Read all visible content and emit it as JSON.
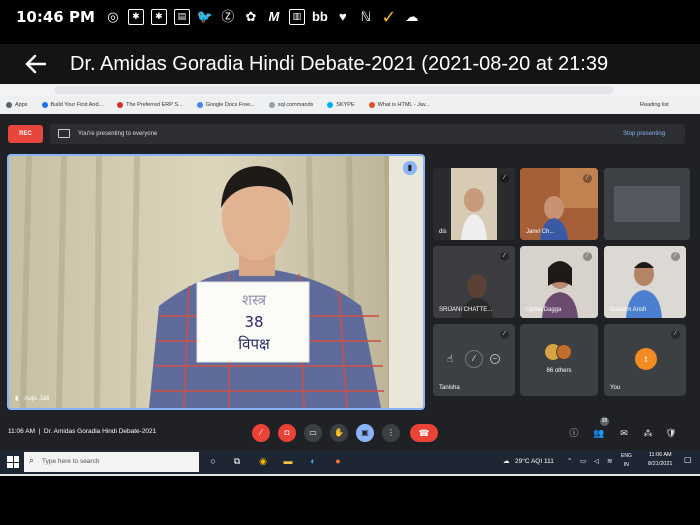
{
  "status_bar": {
    "time": "10:46 PM",
    "icons": [
      "whatsapp-icon",
      "stamp-icon",
      "stamp-icon",
      "flipboard-icon",
      "twitter-icon",
      "z-icon",
      "photos-icon",
      "m-icon",
      "newspaper-icon",
      "bb-icon",
      "heart-icon",
      "nn-icon",
      "check-icon",
      "cloud-icon"
    ]
  },
  "player": {
    "title": "Dr. Amidas Goradia Hindi Debate-2021 (2021-08-20 at 21:39"
  },
  "browser": {
    "bookmarks": [
      "Apps",
      "Build Your First And...",
      "The Preferred ERP S...",
      "Google Docs Free...",
      "sql commands",
      "SKYPE",
      "What is HTML - Jav..."
    ],
    "reading_list": "Reading list"
  },
  "meet": {
    "rec_label": "REC",
    "presenting_text": "You're presenting to everyone",
    "stop_presenting": "Stop presenting",
    "main_speaker_name": "Aujis Jalil",
    "card_text": [
      "शस्त्र",
      "38",
      "विपक्ष"
    ],
    "tiles": [
      {
        "name": "dis",
        "bg": "#d7cbb5"
      },
      {
        "name": "Janvi Ch...",
        "bg": "#b86b3a"
      },
      {
        "name": "",
        "bg": "#4a4d52"
      },
      {
        "name": "SRIJANI CHATTE...",
        "bg": "#3f4144"
      },
      {
        "name": "Upma Dagga",
        "bg": "#cfc8c2"
      },
      {
        "name": "Gautam Ansh",
        "bg": "#d6d3cf"
      },
      {
        "name": "Tanisha",
        "bg": "#3c4043"
      },
      {
        "name": "86 others",
        "bg": "#3c4043"
      },
      {
        "name": "You",
        "bg": "#3c4043"
      }
    ],
    "you_initial": "t",
    "meeting_time": "11:06 AM",
    "meeting_name": "Dr. Amidas Goradia Hindi Debate-2021",
    "participant_count": "98"
  },
  "taskbar": {
    "search_placeholder": "Type here to search",
    "weather": "29°C AQI 111",
    "lang": "ENG",
    "lang2": "IN",
    "clock_time": "11:06 AM",
    "clock_date": "8/21/2021"
  }
}
